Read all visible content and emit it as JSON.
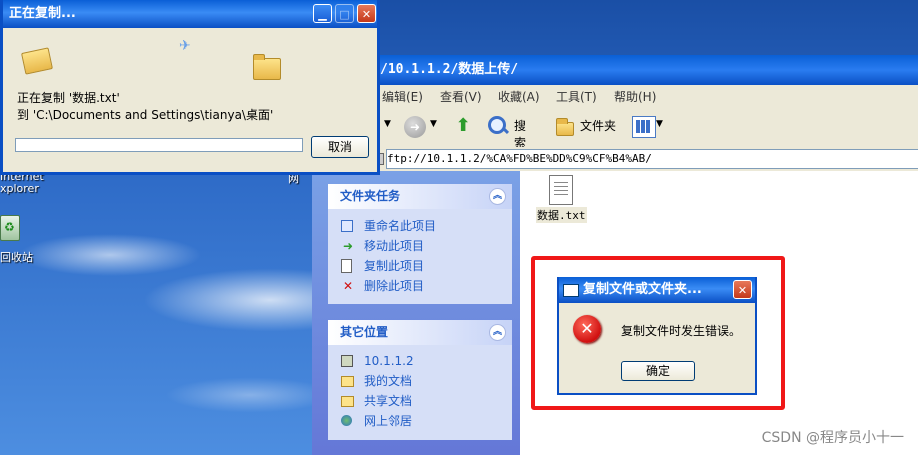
{
  "desktop": {
    "icon_fragments": [
      "Internet",
      "xplorer",
      "回收站"
    ],
    "explorer_icon_fragment": "网"
  },
  "explorer": {
    "address_title": "/10.1.1.2/数据上传/",
    "menu": [
      "编辑(E)",
      "查看(V)",
      "收藏(A)",
      "工具(T)",
      "帮助(H)"
    ],
    "toolbar": {
      "search": "搜索",
      "folders": "文件夹"
    },
    "address": "ftp://10.1.1.2/%CA%FD%BE%DD%C9%CF%B4%AB/",
    "file_tasks": {
      "title": "文件夹任务",
      "items": [
        {
          "label": "重命名此项目",
          "icon": "rename-icon"
        },
        {
          "label": "移动此项目",
          "icon": "move-icon"
        },
        {
          "label": "复制此项目",
          "icon": "copy-icon"
        },
        {
          "label": "删除此项目",
          "icon": "delete-icon"
        }
      ]
    },
    "other_places": {
      "title": "其它位置",
      "items": [
        {
          "label": "10.1.1.2",
          "icon": "server-icon"
        },
        {
          "label": "我的文档",
          "icon": "my-documents-icon"
        },
        {
          "label": "共享文档",
          "icon": "shared-documents-icon"
        },
        {
          "label": "网上邻居",
          "icon": "network-places-icon"
        }
      ]
    },
    "file": {
      "name": "数据.txt"
    }
  },
  "copy_dialog": {
    "title": "正在复制...",
    "line1": "正在复制 '数据.txt'",
    "line2": "到 'C:\\Documents and Settings\\tianya\\桌面'",
    "progress": 0,
    "cancel": "取消"
  },
  "error_dialog": {
    "title": "复制文件或文件夹...",
    "message": "复制文件时发生错误。",
    "ok": "确定"
  },
  "watermark": "CSDN @程序员小十一"
}
